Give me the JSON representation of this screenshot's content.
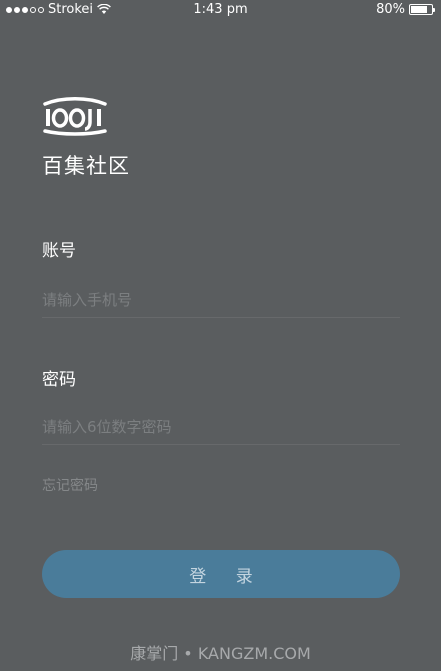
{
  "status_bar": {
    "carrier": "Strokei",
    "time": "1:43 pm",
    "battery": "80%",
    "battery_level": 0.8,
    "signal_icon": "signal-dots-icon",
    "wifi_icon": "wifi-icon"
  },
  "app": {
    "logo_icon": "looji-logo",
    "brand_name": "百集社区"
  },
  "form": {
    "account_label": "账号",
    "account_placeholder": "请输入手机号",
    "account_value": "",
    "password_label": "密码",
    "password_placeholder": "请输入6位数字密码",
    "password_value": "",
    "forgot_password": "忘记密码",
    "login_button": "登 录"
  },
  "watermark": "康掌门 • KANGZM.COM",
  "colors": {
    "background": "#5a5d5f",
    "button": "#4a7c9a",
    "button_text": "#c4d5e0",
    "placeholder": "#7c7f81"
  }
}
